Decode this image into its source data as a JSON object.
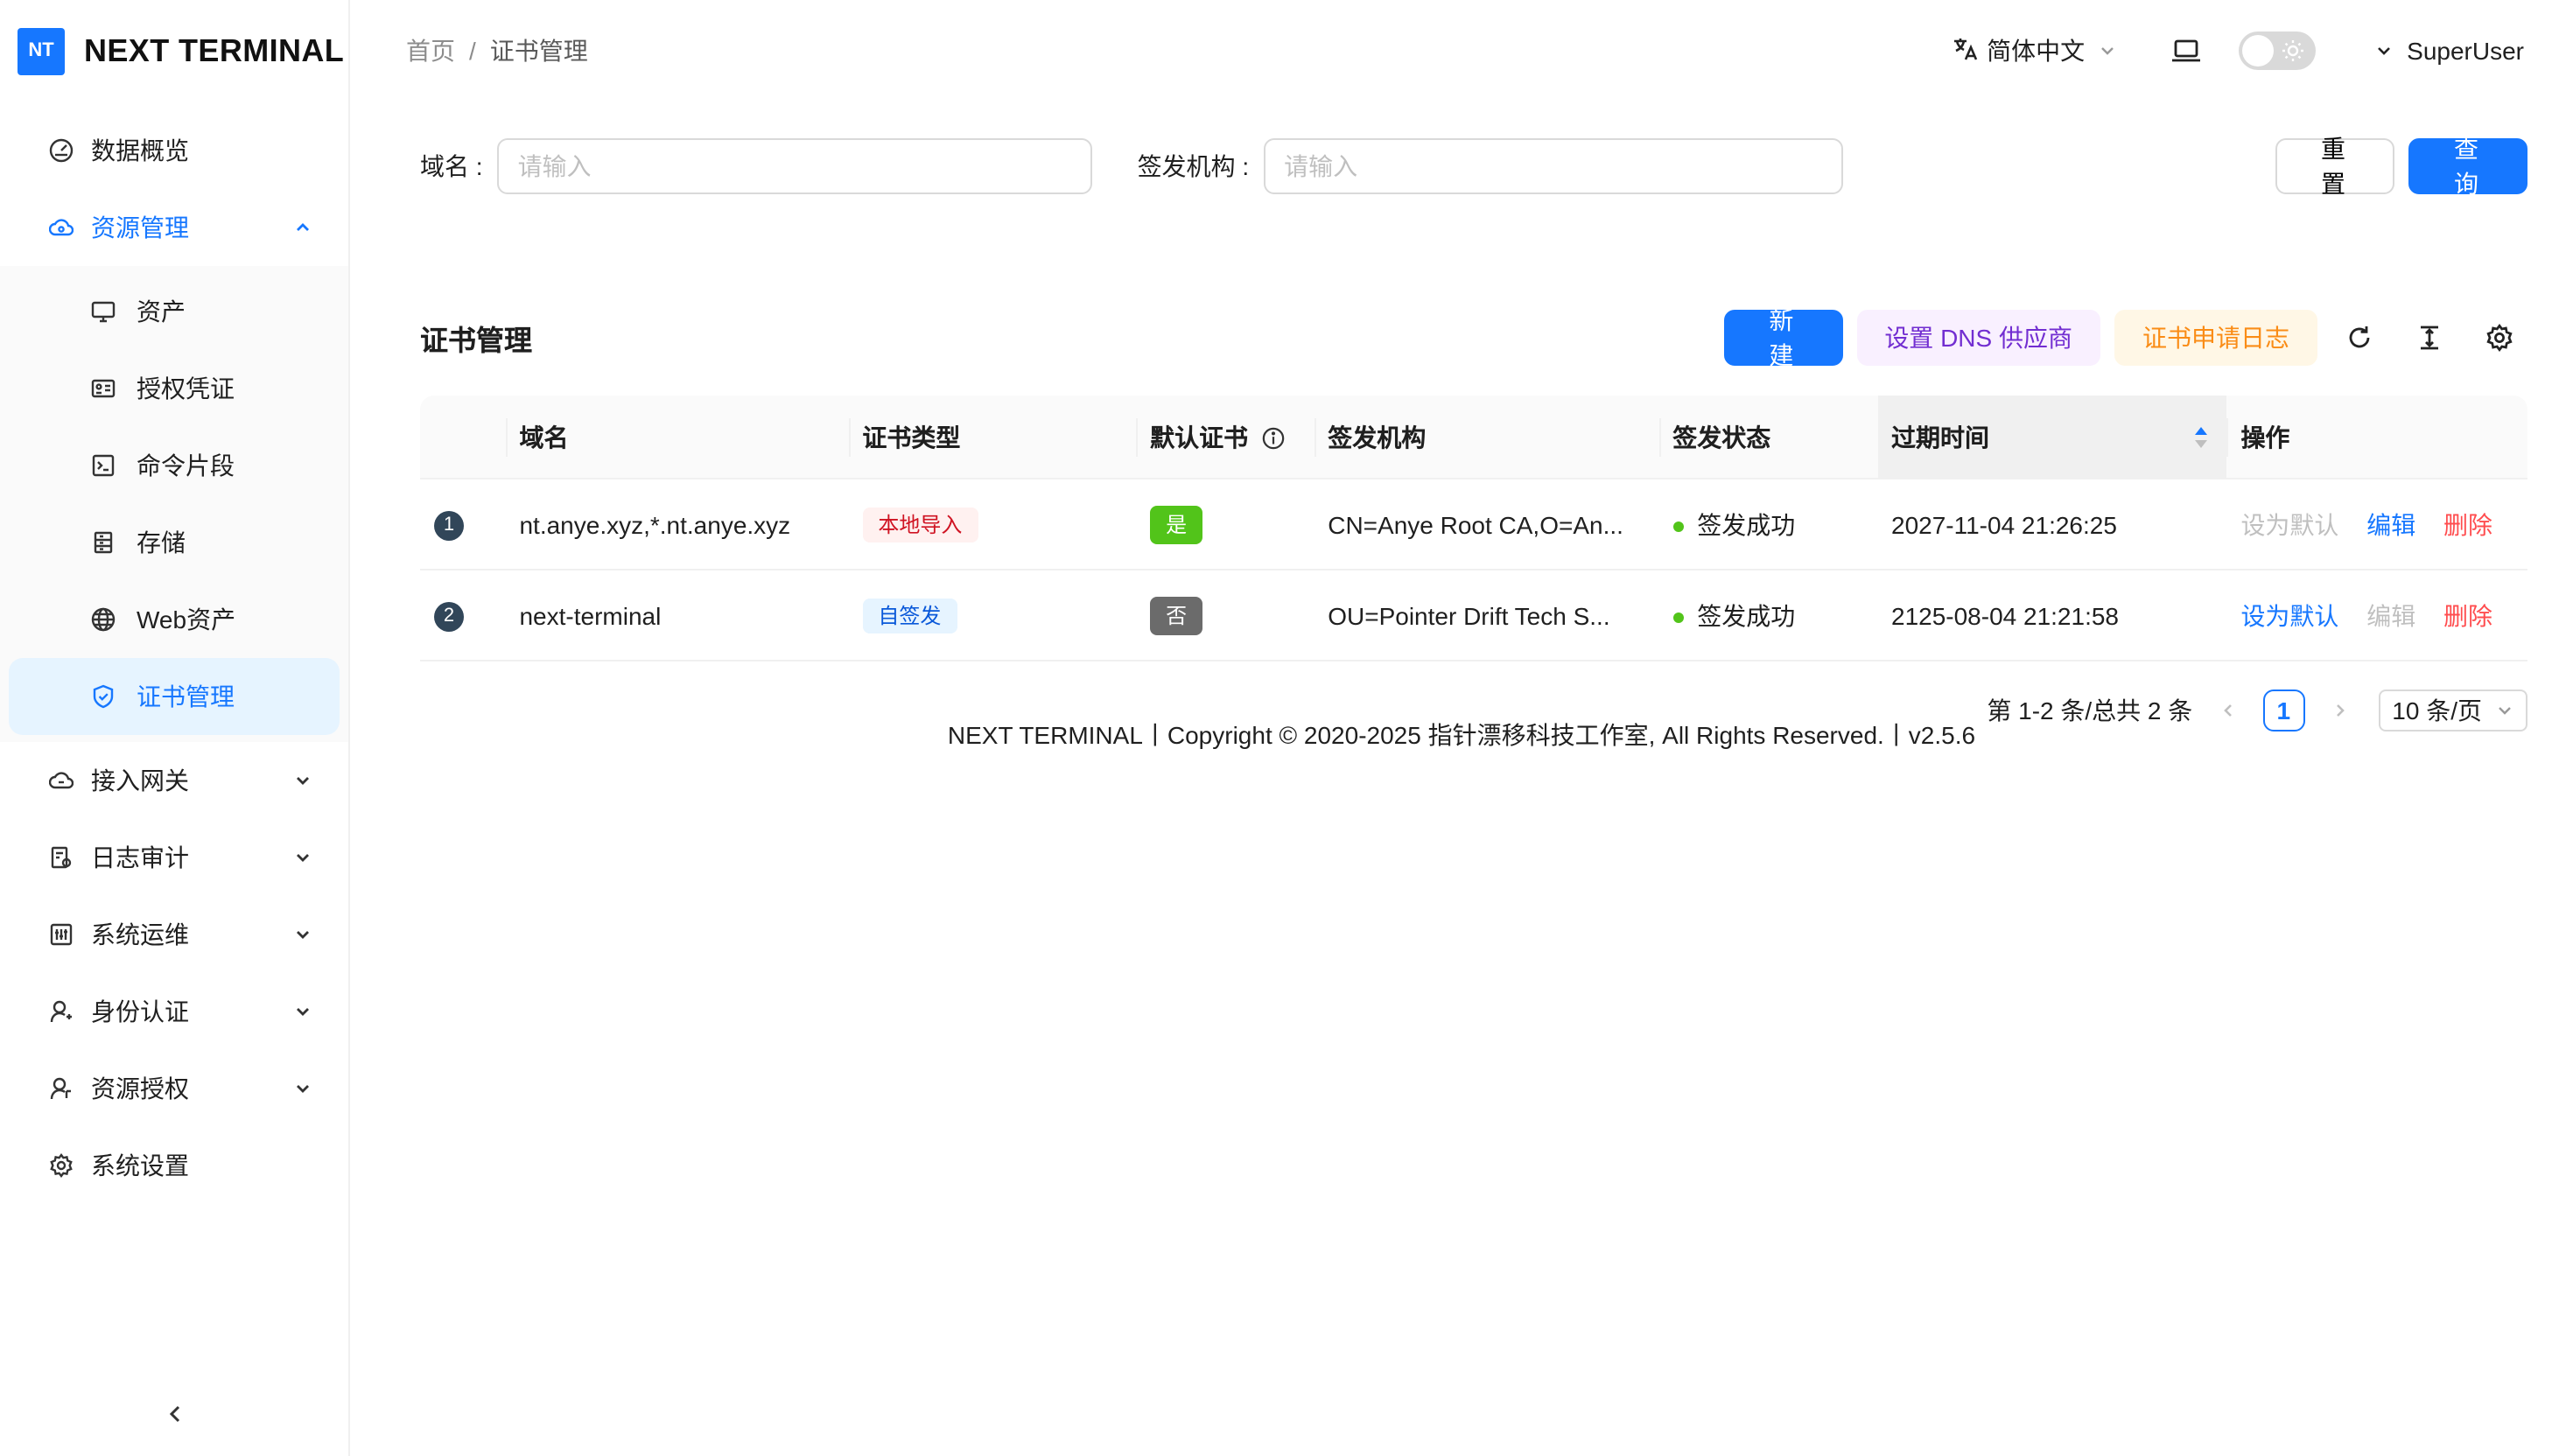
{
  "brand": {
    "logo_text": "NT",
    "name": "NEXT TERMINAL"
  },
  "sidebar": {
    "items": [
      {
        "label": "数据概览",
        "icon": "dashboard-icon"
      },
      {
        "label": "资源管理",
        "icon": "cloud-icon",
        "expanded": true,
        "children": [
          {
            "label": "资产",
            "icon": "desktop-icon"
          },
          {
            "label": "授权凭证",
            "icon": "id-card-icon"
          },
          {
            "label": "命令片段",
            "icon": "code-icon"
          },
          {
            "label": "存储",
            "icon": "database-icon"
          },
          {
            "label": "Web资产",
            "icon": "global-icon"
          },
          {
            "label": "证书管理",
            "icon": "safety-certificate-icon",
            "active": true
          }
        ]
      },
      {
        "label": "接入网关",
        "icon": "gateway-icon"
      },
      {
        "label": "日志审计",
        "icon": "audit-icon"
      },
      {
        "label": "系统运维",
        "icon": "ops-icon"
      },
      {
        "label": "身份认证",
        "icon": "user-icon"
      },
      {
        "label": "资源授权",
        "icon": "user-auth-icon"
      },
      {
        "label": "系统设置",
        "icon": "setting-icon"
      }
    ]
  },
  "header": {
    "breadcrumb": [
      "首页",
      "证书管理"
    ],
    "language": "简体中文",
    "user": "SuperUser"
  },
  "search": {
    "domain_label": "域名",
    "domain_placeholder": "请输入",
    "issuer_label": "签发机构",
    "issuer_placeholder": "请输入",
    "reset_label": "重 置",
    "query_label": "查 询"
  },
  "card": {
    "title": "证书管理",
    "new_label": "新 建",
    "dns_label": "设置 DNS 供应商",
    "log_label": "证书申请日志"
  },
  "table": {
    "columns": [
      "域名",
      "证书类型",
      "默认证书",
      "签发机构",
      "签发状态",
      "过期时间",
      "操作"
    ],
    "rows": [
      {
        "index": "1",
        "domain": "nt.anye.xyz,*.nt.anye.xyz",
        "type": "本地导入",
        "default": "是",
        "issuer": "CN=Anye Root CA,O=An...",
        "status": "签发成功",
        "expire": "2027-11-04 21:26:25",
        "op_default": "设为默认",
        "op_edit": "编辑",
        "op_delete": "删除"
      },
      {
        "index": "2",
        "domain": "next-terminal",
        "type": "自签发",
        "default": "否",
        "issuer": "OU=Pointer Drift Tech S...",
        "status": "签发成功",
        "expire": "2125-08-04 21:21:58",
        "op_default": "设为默认",
        "op_edit": "编辑",
        "op_delete": "删除"
      }
    ]
  },
  "pagination": {
    "summary": "第 1-2 条/总共 2 条",
    "current": "1",
    "page_size": "10 条/页"
  },
  "footer": "NEXT TERMINAL丨Copyright © 2020-2025 指针漂移科技工作室, All Rights Reserved.丨v2.5.6",
  "colors": {
    "primary": "#1677ff",
    "success": "#52c41a",
    "danger": "#ff4d4f",
    "purple": "#722ed1",
    "orange": "#fa8c16"
  }
}
